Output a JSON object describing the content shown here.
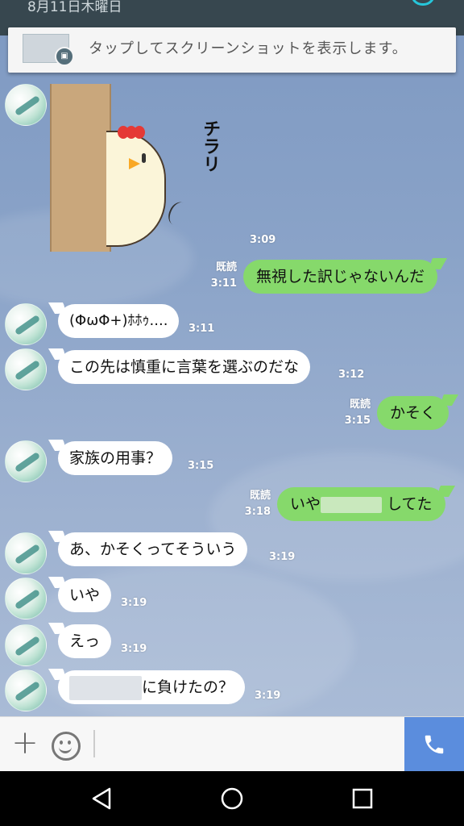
{
  "notification": {
    "date": "8月11日木曜日",
    "message": "タップしてスクリーンショットを表示します。"
  },
  "chat": {
    "sticker": {
      "sticker_text": "チラリ",
      "time": "3:09"
    },
    "messages": [
      {
        "id": "m1",
        "side": "out",
        "text": "無視した訳じゃないんだ",
        "read": "既読",
        "time": "3:11"
      },
      {
        "id": "m2",
        "side": "in",
        "text": "(ΦωΦ+)ﾎﾎｩ....",
        "time": "3:11"
      },
      {
        "id": "m3",
        "side": "in",
        "text": "この先は慎重に言葉を選ぶのだな",
        "time": "3:12"
      },
      {
        "id": "m4",
        "side": "out",
        "text": "かそく",
        "read": "既読",
        "time": "3:15"
      },
      {
        "id": "m5",
        "side": "in",
        "text": "家族の用事？",
        "time": "3:15"
      },
      {
        "id": "m6",
        "side": "out",
        "text_start": "いや",
        "text_end": "してた",
        "read": "既読",
        "time": "3:18"
      },
      {
        "id": "m7",
        "side": "in",
        "text": "あ、かそくってそういう",
        "time": "3:19"
      },
      {
        "id": "m8",
        "side": "in",
        "text": "いや",
        "time": "3:19"
      },
      {
        "id": "m9",
        "side": "in",
        "text": "えっ",
        "time": "3:19"
      },
      {
        "id": "m10",
        "side": "in",
        "text_end": "に負けたの？",
        "time": "3:19"
      }
    ]
  },
  "input": {
    "placeholder": "",
    "plus_icon": "plus-icon",
    "emoji_icon": "smiley-icon",
    "call_icon": "phone-icon"
  },
  "nav": {
    "back": "back-triangle-icon",
    "home": "home-circle-icon",
    "recents": "recents-square-icon"
  },
  "colors": {
    "outgoing_bubble": "#86d96b",
    "incoming_bubble": "#ffffff",
    "chat_background": "#8aa3c8",
    "call_button": "#5b8ddd"
  }
}
